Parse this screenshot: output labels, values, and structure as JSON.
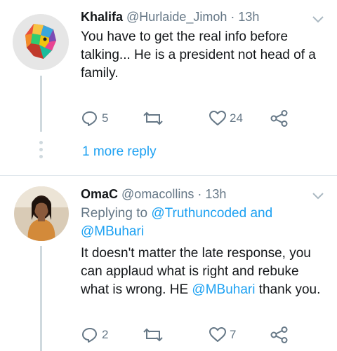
{
  "tweets": [
    {
      "name": "Khalifa",
      "handle": "@Hurlaide_Jimoh",
      "separator": "·",
      "time": "13h",
      "text_lines": [
        "You have to get the real info before",
        "talking... He is a president not head of a",
        "family."
      ],
      "avatar_icon": "colorful-lion-avatar",
      "replies": "5",
      "retweets": "",
      "likes": "24"
    },
    {
      "name": "OmaC",
      "handle": "@omacollins",
      "separator": "·",
      "time": "13h",
      "replying_prefix": "Replying to",
      "replying_to_1": "@Truthuncoded",
      "replying_and": "and",
      "replying_to_2": "@MBuhari",
      "text_part1": "It doesn't matter the late response, you can applaud what is right and rebuke what is wrong. HE",
      "text_mention": "@MBuhari",
      "text_part2": "thank you.",
      "avatar_icon": "woman-photo-avatar",
      "replies": "2",
      "retweets": "",
      "likes": "7"
    }
  ],
  "thread": {
    "more_replies_label": "1 more reply"
  },
  "colors": {
    "accent": "#1da1f2",
    "muted": "#657786",
    "divider": "#e1e8ed"
  }
}
